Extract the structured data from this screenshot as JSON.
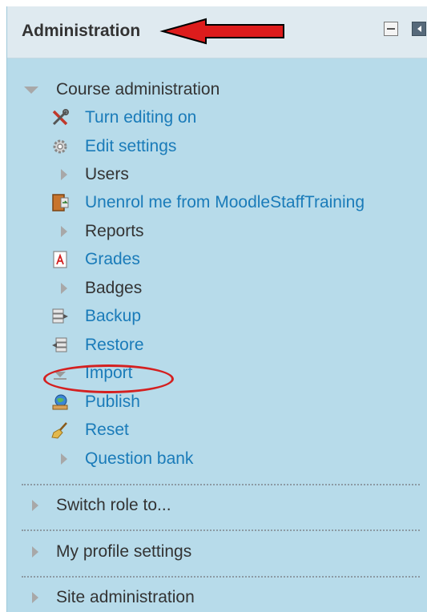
{
  "block": {
    "title": "Administration",
    "controls": {
      "collapse_icon": "minus-box-icon",
      "dock_icon": "dock-arrow-icon"
    }
  },
  "course_admin": {
    "label": "Course administration",
    "items": [
      {
        "label": "Turn editing on",
        "icon": "tools-icon",
        "type": "link"
      },
      {
        "label": "Edit settings",
        "icon": "gear-icon",
        "type": "link"
      },
      {
        "label": "Users",
        "icon": "expand-arrow-icon",
        "type": "branch"
      },
      {
        "label": "Unenrol me from MoodleStaffTraining",
        "icon": "door-exit-icon",
        "type": "link"
      },
      {
        "label": "Reports",
        "icon": "expand-arrow-icon",
        "type": "branch"
      },
      {
        "label": "Grades",
        "icon": "grades-icon",
        "type": "link"
      },
      {
        "label": "Badges",
        "icon": "expand-arrow-icon",
        "type": "branch"
      },
      {
        "label": "Backup",
        "icon": "backup-icon",
        "type": "link"
      },
      {
        "label": "Restore",
        "icon": "restore-icon",
        "type": "link"
      },
      {
        "label": "Import",
        "icon": "import-icon",
        "type": "link"
      },
      {
        "label": "Publish",
        "icon": "publish-icon",
        "type": "link"
      },
      {
        "label": "Reset",
        "icon": "broom-icon",
        "type": "link"
      },
      {
        "label": "Question bank",
        "icon": "expand-arrow-icon",
        "type": "link"
      }
    ]
  },
  "sections": [
    {
      "label": "Switch role to..."
    },
    {
      "label": "My profile settings"
    },
    {
      "label": "Site administration"
    }
  ],
  "colors": {
    "panel_bg": "#b7dbea",
    "header_bg": "#dfeaf0",
    "link": "#1a7bb9",
    "text": "#333333",
    "annotation_red": "#d42020"
  }
}
